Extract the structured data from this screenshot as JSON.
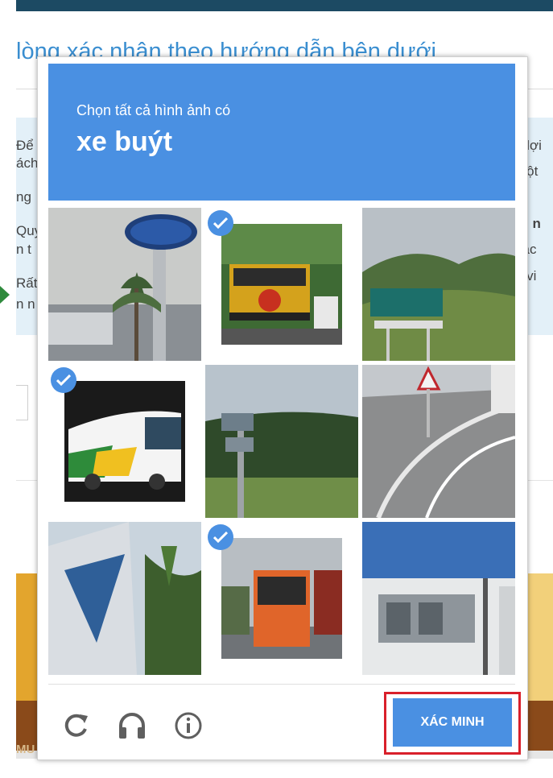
{
  "background": {
    "heading": "lòng xác nhận theo hướng dẫn bên dưới",
    "left_fragments": [
      "Để",
      "ách",
      "ng",
      "Quy",
      "n t",
      "Rất",
      "n n"
    ],
    "right_fragments": [
      "n lợi",
      "một",
      "ời n",
      "xác",
      "g vi"
    ],
    "footer_fragment": "MU"
  },
  "captcha": {
    "instruction": "Chọn tất cả hình ảnh có",
    "target": "xe buýt",
    "tiles": [
      {
        "subject": "ford-sign",
        "selected": false
      },
      {
        "subject": "school-bus",
        "selected": true
      },
      {
        "subject": "road-sign-hills",
        "selected": false
      },
      {
        "subject": "coach-bus",
        "selected": true
      },
      {
        "subject": "street-sign-trees",
        "selected": false
      },
      {
        "subject": "highway-curve",
        "selected": false
      },
      {
        "subject": "blue-sign-palm",
        "selected": false
      },
      {
        "subject": "orange-bus",
        "selected": true
      },
      {
        "subject": "building-sign",
        "selected": false
      }
    ],
    "footer": {
      "icons": [
        "reload-icon",
        "headphones-icon",
        "info-icon"
      ],
      "verify_label": "XÁC MINH"
    }
  },
  "colors": {
    "accent": "#4a90e2",
    "highlight": "#d9202b"
  }
}
